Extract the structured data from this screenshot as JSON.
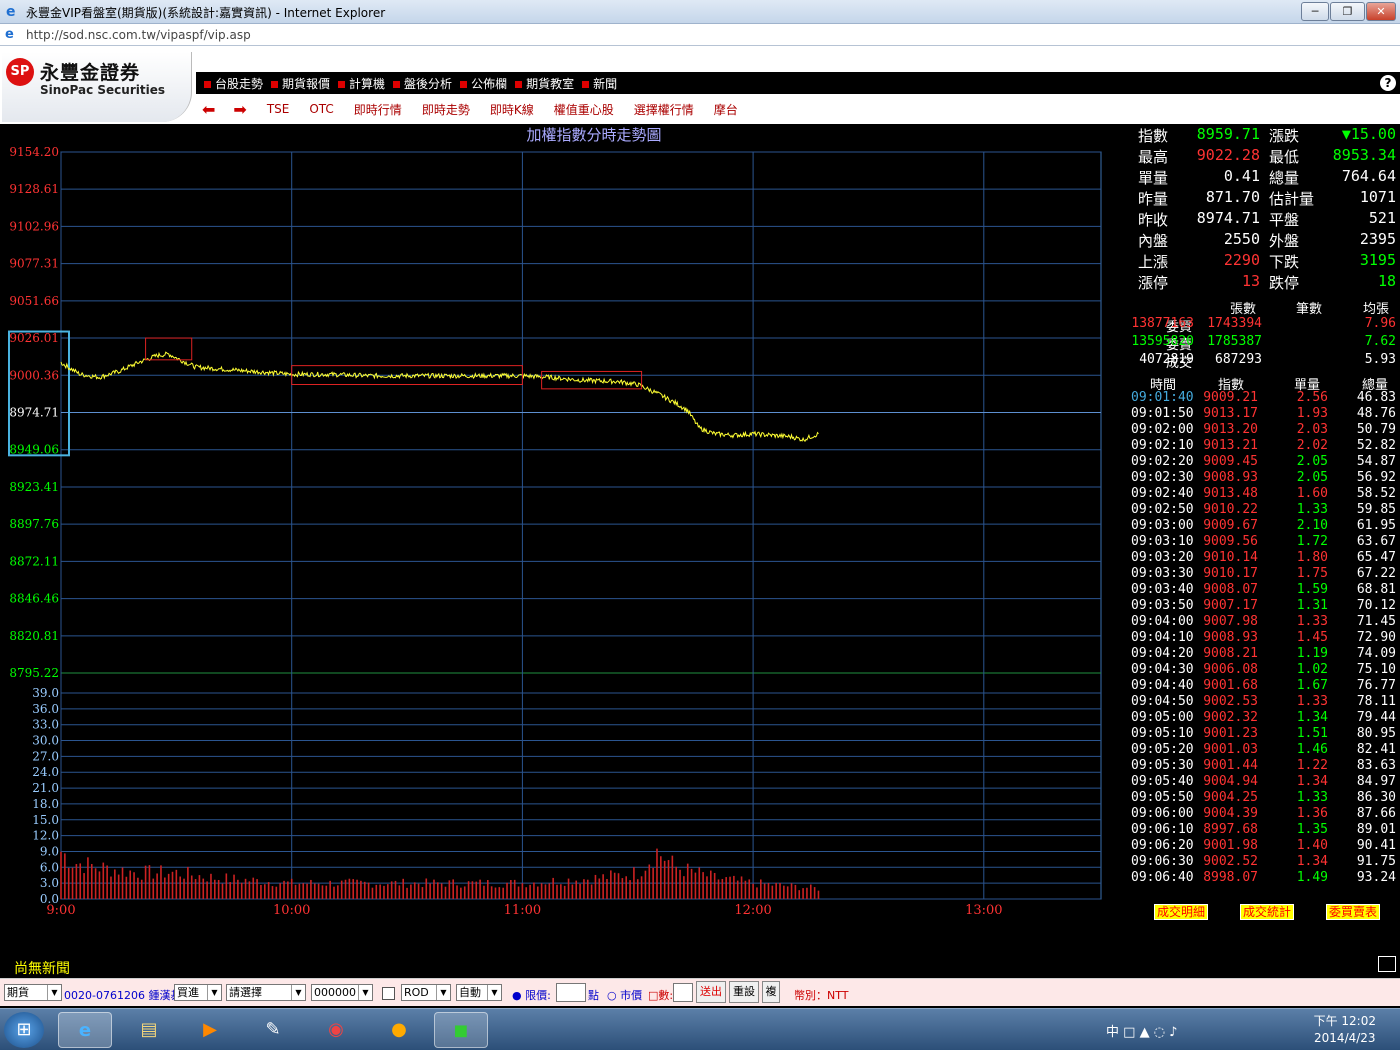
{
  "window": {
    "title": "永豐金VIP看盤室(期貨版)(系統設計:嘉實資訊) - Internet Explorer",
    "url": "http://sod.nsc.com.tw/vipaspf/vip.asp",
    "min": "─",
    "max": "❐",
    "close": "✕"
  },
  "logo": {
    "cn": "永豐金證券",
    "en": "SinoPac Securities",
    "mark": "SP"
  },
  "menu1": [
    "台股走勢",
    "期貨報價",
    "計算機",
    "盤後分析",
    "公佈欄",
    "期貨教室",
    "新聞"
  ],
  "help": "?",
  "menu2": {
    "back": "⬅",
    "forward": "➡",
    "items": [
      "TSE",
      "OTC",
      "即時行情",
      "即時走勢",
      "即時K線",
      "權值重心股",
      "選擇權行情",
      "摩台"
    ]
  },
  "chart_data": {
    "type": "line",
    "title": "加權指數分時走勢圖",
    "x_ticks": [
      "9:00",
      "10:00",
      "11:00",
      "12:00",
      "13:00"
    ],
    "y_ticks_price": [
      9154.2,
      9128.61,
      9102.96,
      9077.31,
      9051.66,
      9026.01,
      9000.36,
      8974.71,
      8949.06,
      8923.41,
      8897.76,
      8872.11,
      8846.46,
      8820.81,
      8795.22
    ],
    "y_ticks_price_text": [
      "9154.20",
      "9128.61",
      "9102.96",
      "9077.31",
      "9051.66",
      "9026.01",
      "9000.36",
      "8974.71",
      "8949.06",
      "8923.41",
      "8897.76",
      "8872.11",
      "8846.46",
      "8820.81",
      "8795.22"
    ],
    "y_ticks_volume": [
      "39.0",
      "36.0",
      "33.0",
      "30.0",
      "27.0",
      "24.0",
      "21.0",
      "18.0",
      "15.0",
      "12.0",
      "9.0",
      "6.0",
      "3.0",
      "0.0"
    ],
    "ylim_price": [
      8795.22,
      9154.2
    ],
    "ylim_volume": [
      0,
      39
    ],
    "reference": 8974.71,
    "price_series": [
      [
        0,
        9009
      ],
      [
        5,
        9001
      ],
      [
        10,
        8999
      ],
      [
        15,
        9003
      ],
      [
        20,
        9009
      ],
      [
        25,
        9014
      ],
      [
        28,
        9015
      ],
      [
        31,
        9011
      ],
      [
        35,
        9006
      ],
      [
        40,
        9005
      ],
      [
        50,
        9003
      ],
      [
        60,
        9001
      ],
      [
        70,
        9001
      ],
      [
        80,
        9000
      ],
      [
        90,
        9000
      ],
      [
        100,
        9000
      ],
      [
        110,
        9000
      ],
      [
        120,
        9000
      ],
      [
        127,
        8999
      ],
      [
        135,
        8997
      ],
      [
        145,
        8996
      ],
      [
        150,
        8994
      ],
      [
        155,
        8988
      ],
      [
        160,
        8981
      ],
      [
        163,
        8976
      ],
      [
        166,
        8964
      ],
      [
        170,
        8960
      ],
      [
        175,
        8959
      ],
      [
        180,
        8960
      ],
      [
        185,
        8959
      ],
      [
        190,
        8958
      ],
      [
        193,
        8956
      ],
      [
        195,
        8958
      ],
      [
        197,
        8960
      ]
    ],
    "volume_series": [
      [
        0,
        9
      ],
      [
        3,
        7
      ],
      [
        10,
        6
      ],
      [
        20,
        5
      ],
      [
        30,
        5
      ],
      [
        40,
        4
      ],
      [
        60,
        3
      ],
      [
        80,
        3
      ],
      [
        100,
        3
      ],
      [
        120,
        3
      ],
      [
        140,
        4
      ],
      [
        150,
        5
      ],
      [
        155,
        9
      ],
      [
        160,
        6
      ],
      [
        170,
        4
      ],
      [
        180,
        3
      ],
      [
        197,
        2
      ]
    ],
    "grid": "on"
  },
  "quote": [
    {
      "l": "指數",
      "v": "8959.71",
      "l2": "漲跌",
      "v2": "▼15.00",
      "c": "#0f0",
      "c2": "#0f0"
    },
    {
      "l": "最高",
      "v": "9022.28",
      "l2": "最低",
      "v2": "8953.34",
      "c": "#f33",
      "c2": "#0f0"
    },
    {
      "l": "單量",
      "v": "0.41",
      "l2": "總量",
      "v2": "764.64",
      "c": "#fff",
      "c2": "#fff"
    },
    {
      "l": "昨量",
      "v": "871.70",
      "l2": "估計量",
      "v2": "1071",
      "c": "#fff",
      "c2": "#fff"
    },
    {
      "l": "昨收",
      "v": "8974.71",
      "l2": "平盤",
      "v2": "521",
      "c": "#fff",
      "c2": "#fff"
    },
    {
      "l": "內盤",
      "v": "2550",
      "l2": "外盤",
      "v2": "2395",
      "c": "#fff",
      "c2": "#fff"
    },
    {
      "l": "上漲",
      "v": "2290",
      "l2": "下跌",
      "v2": "3195",
      "c": "#f33",
      "c2": "#0f0"
    },
    {
      "l": "漲停",
      "v": "13",
      "l2": "跌停",
      "v2": "18",
      "c": "#f33",
      "c2": "#0f0"
    }
  ],
  "book": {
    "headers": [
      "張數",
      "筆數",
      "均張"
    ],
    "rows": [
      {
        "l": "委買",
        "a": "13877163",
        "b": "1743394",
        "c": "7.96",
        "ca": "#f33",
        "cb": "#f33",
        "cc": "#f33"
      },
      {
        "l": "委賣",
        "a": "13595820",
        "b": "1785387",
        "c": "7.62",
        "ca": "#0f0",
        "cb": "#0f0",
        "cc": "#0f0"
      },
      {
        "l": "成交",
        "a": "4072819",
        "b": "687293",
        "c": "5.93",
        "ca": "#fff",
        "cb": "#fff",
        "cc": "#fff"
      }
    ]
  },
  "ticks": {
    "headers": [
      "時間",
      "指數",
      "單量",
      "總量"
    ],
    "rows": [
      [
        "09:01:40",
        "9009.21",
        "2.56",
        "46.83",
        "r"
      ],
      [
        "09:01:50",
        "9013.17",
        "1.93",
        "48.76",
        "r"
      ],
      [
        "09:02:00",
        "9013.20",
        "2.03",
        "50.79",
        "r"
      ],
      [
        "09:02:10",
        "9013.21",
        "2.02",
        "52.82",
        "r"
      ],
      [
        "09:02:20",
        "9009.45",
        "2.05",
        "54.87",
        "g"
      ],
      [
        "09:02:30",
        "9008.93",
        "2.05",
        "56.92",
        "g"
      ],
      [
        "09:02:40",
        "9013.48",
        "1.60",
        "58.52",
        "r"
      ],
      [
        "09:02:50",
        "9010.22",
        "1.33",
        "59.85",
        "g"
      ],
      [
        "09:03:00",
        "9009.67",
        "2.10",
        "61.95",
        "g"
      ],
      [
        "09:03:10",
        "9009.56",
        "1.72",
        "63.67",
        "g"
      ],
      [
        "09:03:20",
        "9010.14",
        "1.80",
        "65.47",
        "r"
      ],
      [
        "09:03:30",
        "9010.17",
        "1.75",
        "67.22",
        "r"
      ],
      [
        "09:03:40",
        "9008.07",
        "1.59",
        "68.81",
        "g"
      ],
      [
        "09:03:50",
        "9007.17",
        "1.31",
        "70.12",
        "g"
      ],
      [
        "09:04:00",
        "9007.98",
        "1.33",
        "71.45",
        "r"
      ],
      [
        "09:04:10",
        "9008.93",
        "1.45",
        "72.90",
        "r"
      ],
      [
        "09:04:20",
        "9008.21",
        "1.19",
        "74.09",
        "g"
      ],
      [
        "09:04:30",
        "9006.08",
        "1.02",
        "75.10",
        "g"
      ],
      [
        "09:04:40",
        "9001.68",
        "1.67",
        "76.77",
        "g"
      ],
      [
        "09:04:50",
        "9002.53",
        "1.33",
        "78.11",
        "r"
      ],
      [
        "09:05:00",
        "9002.32",
        "1.34",
        "79.44",
        "g"
      ],
      [
        "09:05:10",
        "9001.23",
        "1.51",
        "80.95",
        "g"
      ],
      [
        "09:05:20",
        "9001.03",
        "1.46",
        "82.41",
        "g"
      ],
      [
        "09:05:30",
        "9001.44",
        "1.22",
        "83.63",
        "r"
      ],
      [
        "09:05:40",
        "9004.94",
        "1.34",
        "84.97",
        "r"
      ],
      [
        "09:05:50",
        "9004.25",
        "1.33",
        "86.30",
        "g"
      ],
      [
        "09:06:00",
        "9004.39",
        "1.36",
        "87.66",
        "r"
      ],
      [
        "09:06:10",
        "8997.68",
        "1.35",
        "89.01",
        "g"
      ],
      [
        "09:06:20",
        "9001.98",
        "1.40",
        "90.41",
        "r"
      ],
      [
        "09:06:30",
        "9002.52",
        "1.34",
        "91.75",
        "r"
      ],
      [
        "09:06:40",
        "8998.07",
        "1.49",
        "93.24",
        "g"
      ]
    ]
  },
  "buttons": {
    "detail": "成交明細",
    "stats": "成交統計",
    "bidask": "委買賣表"
  },
  "news": "尚無新聞",
  "order": {
    "product": "期貨",
    "account": "0020-0761206 鍾漢碁",
    "side": "買進",
    "select": "請選擇",
    "qty": "000000",
    "rod": "ROD",
    "auto": "自動",
    "limit": "限價:",
    "point": "點",
    "market": "市價",
    "count": "數:",
    "send": "送出",
    "reset": "重設",
    "copy": "複",
    "currency": "幣別：NTT"
  },
  "taskbar": {
    "time": "下午 12:02",
    "date": "2014/4/23",
    "ime": "中"
  }
}
